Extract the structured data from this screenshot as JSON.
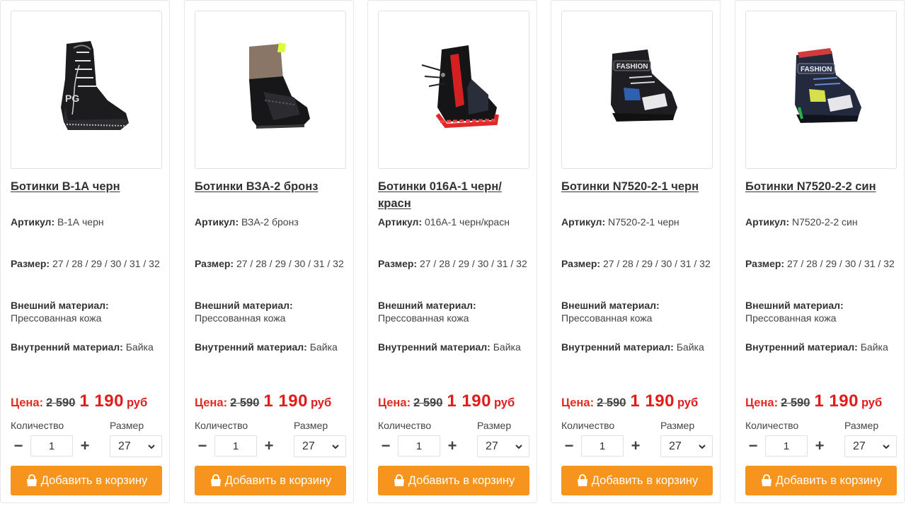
{
  "labels": {
    "article": "Артикул:",
    "size": "Размер:",
    "outer_material": "Внешний материал:",
    "inner_material": "Внутренний материал:",
    "price": "Цена:",
    "quantity": "Количество",
    "size_select": "Размер",
    "add_to_cart": "Добавить в корзину",
    "minus": "−",
    "plus": "+"
  },
  "colors": {
    "accent": "#f7941d",
    "price_red": "#e01c1c"
  },
  "products": [
    {
      "title": "Ботинки В-1А черн",
      "article": "В-1А черн",
      "sizes": "27 / 28 / 29 / 30 / 31 / 32",
      "outer_material": "Прессованная кожа",
      "inner_material": "Байка",
      "old_price": "2 590",
      "new_price": "1 190",
      "currency": "руб",
      "quantity": "1",
      "selected_size": "27",
      "image": "black-lace-up-boot"
    },
    {
      "title": "Ботинки ВЗА-2 бронз",
      "article": "ВЗА-2 бронз",
      "sizes": "27 / 28 / 29 / 30 / 31 / 32",
      "outer_material": "Прессованная кожа",
      "inner_material": "Байка",
      "old_price": "2 590",
      "new_price": "1 190",
      "currency": "руб",
      "quantity": "1",
      "selected_size": "27",
      "image": "bronze-top-boot"
    },
    {
      "title": "Ботинки 016А-1 черн/красн",
      "article": "016А-1 черн/красн",
      "sizes": "27 / 28 / 29 / 30 / 31 / 32",
      "outer_material": "Прессованная кожа",
      "inner_material": "Байка",
      "old_price": "2 590",
      "new_price": "1 190",
      "currency": "руб",
      "quantity": "1",
      "selected_size": "27",
      "image": "black-red-sneaker-boot"
    },
    {
      "title": "Ботинки N7520-2-1 черн",
      "article": "N7520-2-1 черн",
      "sizes": "27 / 28 / 29 / 30 / 31 / 32",
      "outer_material": "Прессованная кожа",
      "inner_material": "Байка",
      "old_price": "2 590",
      "new_price": "1 190",
      "currency": "руб",
      "quantity": "1",
      "selected_size": "27",
      "image": "black-fashion-sneaker",
      "logo_text": "FASHION"
    },
    {
      "title": "Ботинки N7520-2-2 син",
      "article": "N7520-2-2 син",
      "sizes": "27 / 28 / 29 / 30 / 31 / 32",
      "outer_material": "Прессованная кожа",
      "inner_material": "Байка",
      "old_price": "2 590",
      "new_price": "1 190",
      "currency": "руб",
      "quantity": "1",
      "selected_size": "27",
      "image": "navy-fashion-sneaker",
      "logo_text": "FASHION"
    }
  ]
}
